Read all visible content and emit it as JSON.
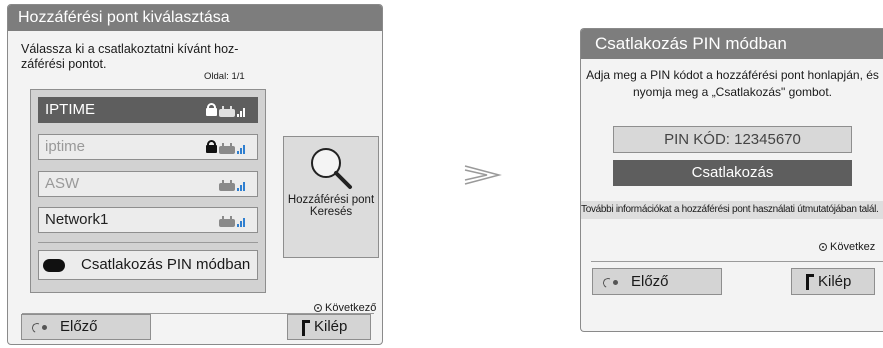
{
  "left_dialog": {
    "title": "Hozzáférési pont kiválasztása",
    "instruction": "Válassza ki a csatlakoztatni kívánt hozzáférési pontot.",
    "instruction_line1": "Válassza ki a csatlakoztatni kívánt hoz-",
    "instruction_line2": "záférési pontot.",
    "page": "Oldal: 1/1",
    "access_points": [
      {
        "name": "IPTIME",
        "locked": true,
        "selected": true
      },
      {
        "name": "iptime",
        "locked": true,
        "selected": false
      },
      {
        "name": "ASW",
        "locked": false,
        "selected": false
      },
      {
        "name": "Network1",
        "locked": false,
        "selected": false
      }
    ],
    "pin_mode_label": "Csatlakozás PIN módban",
    "search_label_line1": "Hozzáférési pont",
    "search_label_line2": "Keresés",
    "next_label": "Következő",
    "back_label": "Előző",
    "exit_label": "Kilép"
  },
  "right_dialog": {
    "title": "Csatlakozás PIN módban",
    "info_line1": "Adja meg a PIN kódot a hozzáférési pont honlapján, és",
    "info_line2": "nyomja meg a „Csatlakozás\" gombot.",
    "pin_code": "PIN KÓD: 12345670",
    "connect_label": "Csatlakozás",
    "more_info": "További információkat a hozzáférési pont használati útmutatójában talál.",
    "next_label": "Következ",
    "back_label": "Előző",
    "exit_label": "Kilép"
  },
  "icons": {
    "lock": "lock-icon",
    "router": "router-signal-icon",
    "search": "magnifier-icon",
    "back": "back-icon",
    "exit": "exit-icon",
    "next": "next-dot-icon",
    "arrow": "transition-arrow-icon"
  },
  "colors": {
    "title_bar": "#7d7d7d",
    "selected_item": "#5e5e5e",
    "signal": "#2f7fd0"
  }
}
